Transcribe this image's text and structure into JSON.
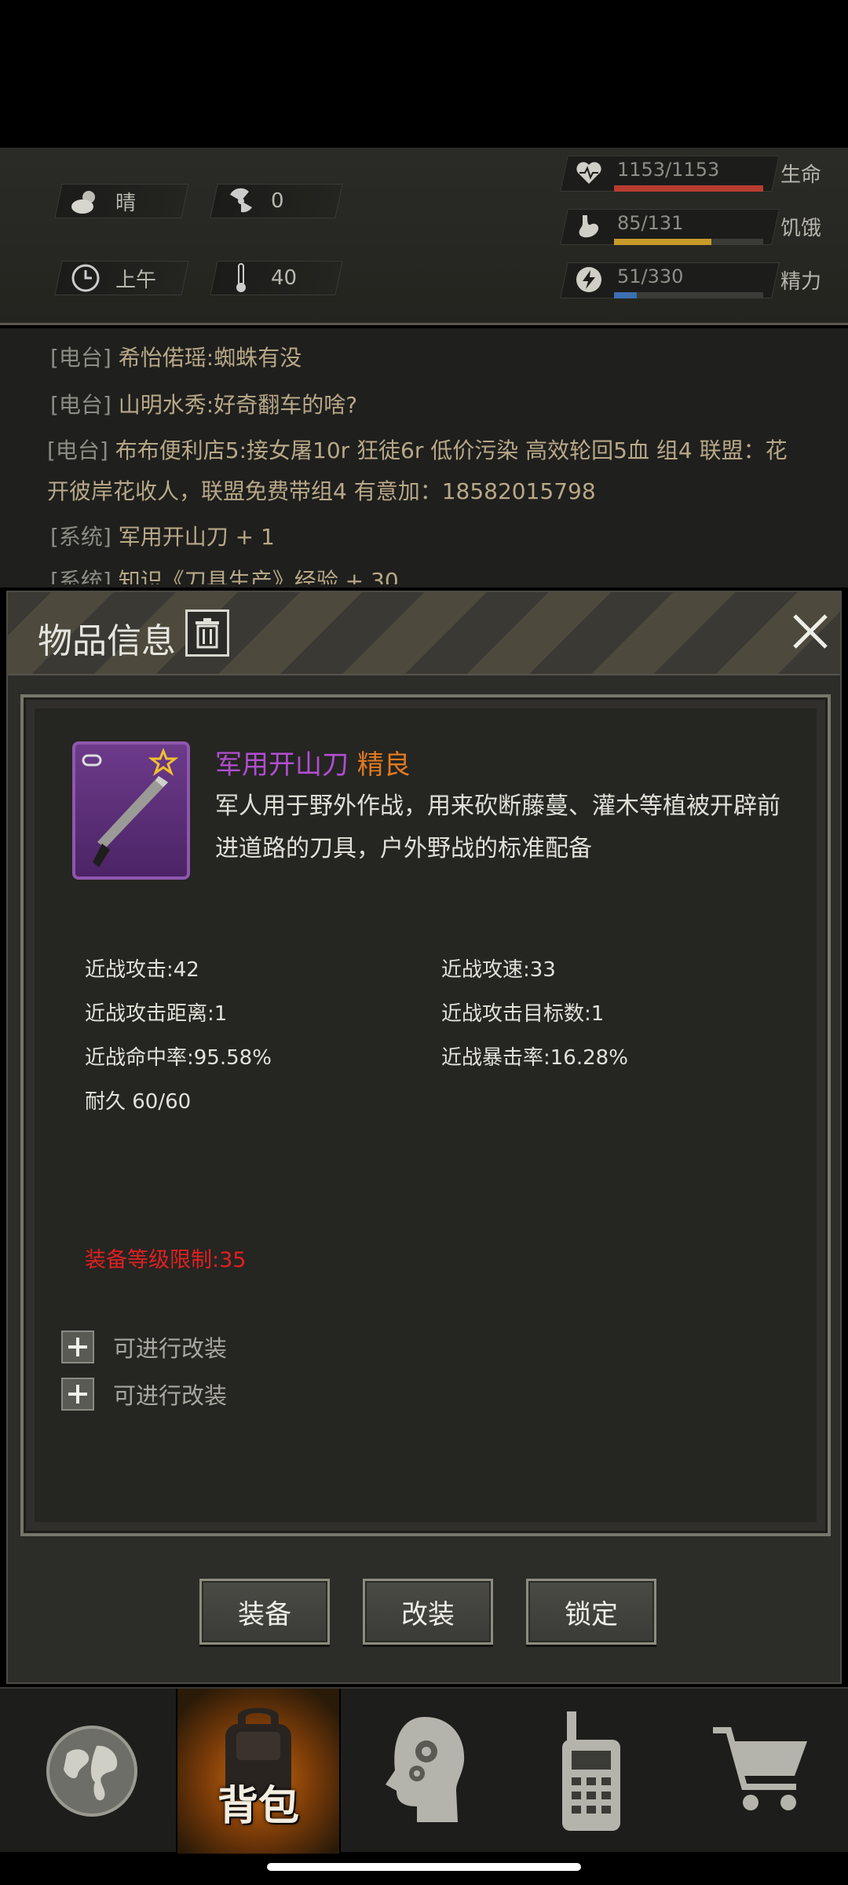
{
  "status": {
    "weather": {
      "icon": "cloud-sun-icon",
      "label": "晴"
    },
    "radiation": {
      "icon": "radiation-icon",
      "value": "0"
    },
    "time": {
      "icon": "clock-icon",
      "label": "上午"
    },
    "temperature": {
      "icon": "thermometer-icon",
      "value": "40"
    },
    "health": {
      "value": "1153/1153",
      "label": "生命",
      "fraction": 1.0,
      "color": "#b73c2f"
    },
    "hunger": {
      "value": "85/131",
      "label": "饥饿",
      "fraction": 0.65,
      "color": "#c89a2a"
    },
    "energy": {
      "value": "51/330",
      "label": "精力",
      "fraction": 0.155,
      "color": "#3a6fb0"
    }
  },
  "chat": [
    {
      "channel": "[电台]",
      "message": "希怡偌瑶:蜘蛛有没"
    },
    {
      "channel": "[电台]",
      "message": "山明水秀:好奇翻车的啥?"
    },
    {
      "channel": "[电台]",
      "message": "布布便利店5:接女屠10r 狂徒6r 低价污染 高效轮回5血 组4 联盟：花",
      "message2": "开彼岸花收人，联盟免费带组4 有意加：18582015798"
    },
    {
      "channel": "[系统]",
      "message": "军用开山刀 + 1"
    },
    {
      "channel": "[系统]",
      "message": "知识《刀具生产》经验 + 30"
    }
  ],
  "dialog": {
    "title": "物品信息",
    "item": {
      "name": "军用开山刀",
      "quality": "精良",
      "description": "军人用于野外作战，用来砍断藤蔓、灌木等植被开辟前进道路的刀具，户外野战的标准配备",
      "attributes": {
        "melee_attack": "近战攻击:42",
        "melee_speed": "近战攻速:33",
        "melee_range": "近战攻击距离:1",
        "melee_targets": "近战攻击目标数:1",
        "melee_hit": "近战命中率:95.58%",
        "melee_crit": "近战暴击率:16.28%",
        "durability": "耐久 60/60"
      },
      "requirement": "装备等级限制:35",
      "mod_slots": [
        "可进行改装",
        "可进行改装"
      ]
    },
    "buttons": {
      "equip": "装备",
      "modify": "改装",
      "lock": "锁定"
    }
  },
  "nav": {
    "tabs": [
      {
        "name": "world",
        "icon": "globe-icon"
      },
      {
        "name": "bag",
        "icon": "backpack-icon",
        "label": "背包",
        "active": true
      },
      {
        "name": "skills",
        "icon": "head-gears-icon"
      },
      {
        "name": "radio",
        "icon": "walkie-talkie-icon"
      },
      {
        "name": "shop",
        "icon": "cart-icon"
      }
    ]
  }
}
